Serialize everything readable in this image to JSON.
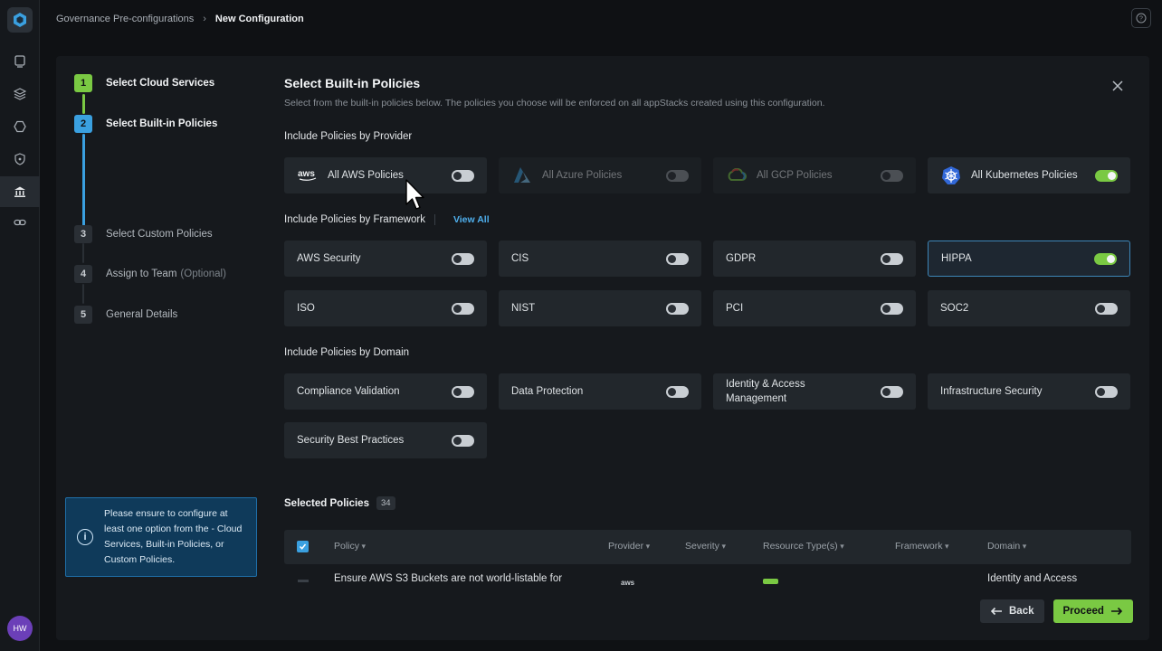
{
  "breadcrumb": {
    "parent": "Governance Pre-configurations",
    "current": "New Configuration"
  },
  "steps": [
    {
      "num": "1",
      "label": "Select Cloud Services",
      "optional": ""
    },
    {
      "num": "2",
      "label": "Select Built-in Policies",
      "optional": ""
    },
    {
      "num": "3",
      "label": "Select Custom Policies",
      "optional": ""
    },
    {
      "num": "4",
      "label": "Assign to Team",
      "optional": "(Optional)"
    },
    {
      "num": "5",
      "label": "General Details",
      "optional": ""
    }
  ],
  "info": {
    "text": "Please ensure to configure at least one option from the - Cloud Services, Built-in Policies, or Custom Policies."
  },
  "user": {
    "initials": "HW"
  },
  "header": {
    "title": "Select Built-in Policies",
    "subtitle": "Select from the built-in policies below. The policies you choose will be enforced on all appStacks created using this configuration."
  },
  "provider": {
    "section": "Include Policies by Provider",
    "items": [
      {
        "label": "All AWS Policies",
        "on": false,
        "icon": "aws-logo-icon"
      },
      {
        "label": "All Azure Policies",
        "on": false,
        "icon": "azure-logo-icon"
      },
      {
        "label": "All GCP Policies",
        "on": false,
        "icon": "gcp-logo-icon"
      },
      {
        "label": "All Kubernetes Policies",
        "on": true,
        "icon": "kubernetes-logo-icon"
      }
    ],
    "aws_logo_text": "aws"
  },
  "framework": {
    "section": "Include Policies by Framework",
    "view_all": "View All",
    "items": [
      {
        "label": "AWS Security",
        "on": false
      },
      {
        "label": "CIS",
        "on": false
      },
      {
        "label": "GDPR",
        "on": false
      },
      {
        "label": "HIPPA",
        "on": true
      },
      {
        "label": "ISO",
        "on": false
      },
      {
        "label": "NIST",
        "on": false
      },
      {
        "label": "PCI",
        "on": false
      },
      {
        "label": "SOC2",
        "on": false
      }
    ]
  },
  "domain": {
    "section": "Include Policies by Domain",
    "items": [
      {
        "label": "Compliance Validation",
        "on": false
      },
      {
        "label": "Data Protection",
        "on": false
      },
      {
        "label": "Identity & Access Management",
        "on": false
      },
      {
        "label": "Infrastructure Security",
        "on": false
      },
      {
        "label": "Security Best Practices",
        "on": false
      }
    ]
  },
  "selected": {
    "title": "Selected Policies",
    "count": "34",
    "columns": [
      "Policy",
      "Provider",
      "Severity",
      "Resource Type(s)",
      "Framework",
      "Domain"
    ],
    "row": {
      "policy": "Ensure AWS S3 Buckets are not world-listable for",
      "provider": "aws",
      "domain": "Identity and Access"
    }
  },
  "footer": {
    "back": "Back",
    "proceed": "Proceed"
  },
  "colors": {
    "accent_green": "#7ac943",
    "accent_blue": "#3aa0e0"
  }
}
